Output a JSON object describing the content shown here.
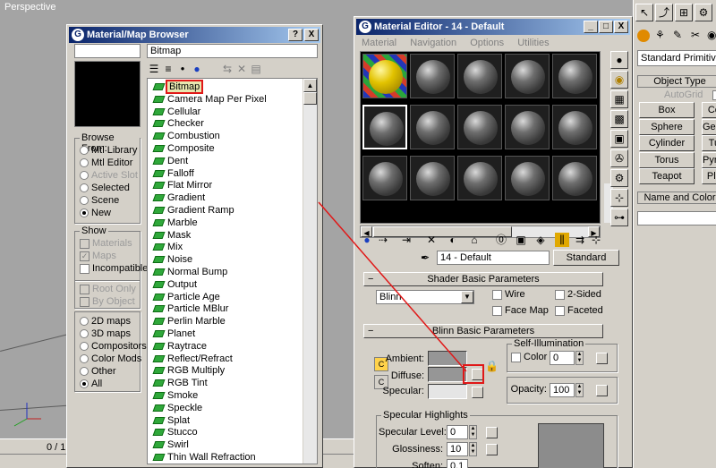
{
  "viewport": {
    "label": "Perspective",
    "frame_counter": "0 / 1"
  },
  "browser": {
    "title": "Material/Map Browser",
    "help_label": "?",
    "close_label": "X",
    "path": "Bitmap",
    "browse_from": {
      "title": "Browse From:",
      "options": [
        {
          "label": "Mtl Library",
          "enabled": true
        },
        {
          "label": "Mtl Editor",
          "enabled": true
        },
        {
          "label": "Active Slot",
          "enabled": false
        },
        {
          "label": "Selected",
          "enabled": true
        },
        {
          "label": "Scene",
          "enabled": true
        },
        {
          "label": "New",
          "enabled": true
        }
      ],
      "selected": "New"
    },
    "show": {
      "title": "Show",
      "materials": "Materials",
      "maps": "Maps",
      "incompatible": "Incompatible",
      "root_only": "Root Only",
      "by_object": "By Object",
      "map_types": [
        "2D maps",
        "3D maps",
        "Compositors",
        "Color Mods",
        "Other",
        "All"
      ],
      "selected_map_type": "All"
    },
    "maps": [
      "Bitmap",
      "Camera Map Per Pixel",
      "Cellular",
      "Checker",
      "Combustion",
      "Composite",
      "Dent",
      "Falloff",
      "Flat Mirror",
      "Gradient",
      "Gradient Ramp",
      "Marble",
      "Mask",
      "Mix",
      "Noise",
      "Normal Bump",
      "Output",
      "Particle Age",
      "Particle MBlur",
      "Perlin Marble",
      "Planet",
      "Raytrace",
      "Reflect/Refract",
      "RGB Multiply",
      "RGB Tint",
      "Smoke",
      "Speckle",
      "Splat",
      "Stucco",
      "Swirl",
      "Thin Wall Refraction"
    ],
    "selected_map": "Bitmap"
  },
  "editor": {
    "title": "Material Editor - 14 - Default",
    "menu": [
      "Material",
      "Navigation",
      "Options",
      "Utilities"
    ],
    "minimize_label": "_",
    "maximize_label": "□",
    "close_label": "X",
    "material_name": "14 - Default",
    "material_type": "Standard",
    "shader_rollout": {
      "title": "Shader Basic Parameters",
      "shader": "Blinn",
      "wire": "Wire",
      "two_sided": "2-Sided",
      "face_map": "Face Map",
      "faceted": "Faceted"
    },
    "blinn_rollout": {
      "title": "Blinn Basic Parameters",
      "ambient": "Ambient:",
      "diffuse": "Diffuse:",
      "specular": "Specular:",
      "self_illum_title": "Self-Illumination",
      "color_label": "Color",
      "color_value": "0",
      "opacity_label": "Opacity:",
      "opacity_value": "100",
      "ambient_color": "#969696",
      "diffuse_color": "#969696",
      "specular_color": "#e5e5e5"
    },
    "specular_highlights": {
      "title": "Specular Highlights",
      "level_label": "Specular Level:",
      "level_value": "0",
      "gloss_label": "Glossiness:",
      "gloss_value": "10",
      "soften_label": "Soften:",
      "soften_value": "0.1"
    }
  },
  "command_panel": {
    "dropdown": "Standard Primitives",
    "object_type": "Object Type",
    "autogrid": "AutoGrid",
    "buttons": [
      "Box",
      "Cone",
      "Sphere",
      "GeoSphere",
      "Cylinder",
      "Tube",
      "Torus",
      "Pyramid",
      "Teapot",
      "Plane"
    ],
    "name_and_color": "Name and Color"
  },
  "colors": {
    "annotation_red": "#e01818",
    "title_start": "#0a246a",
    "title_end": "#a6caf0"
  }
}
